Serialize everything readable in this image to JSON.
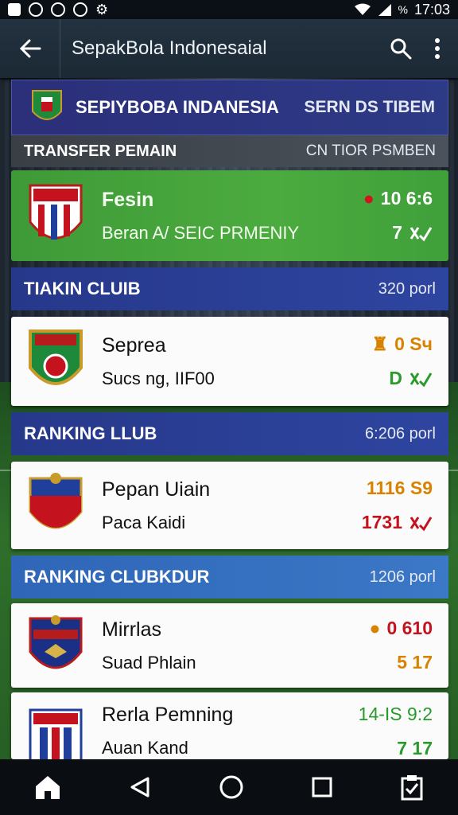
{
  "status": {
    "battery": "%",
    "time": "17:03"
  },
  "appbar": {
    "title": "SepakBola Indonesaial"
  },
  "header": {
    "league": "SEPIYBOBA INDANESIA",
    "right": "SERN DS TIBEM"
  },
  "transfer": {
    "title": "TRANSFER PEMAIN",
    "right": "CN TIOR PSMBEN"
  },
  "highlight": {
    "name": "Fesin",
    "sub": "Beran A/ SEIC PRMENIY",
    "stat1": "10 6:6",
    "stat2": "7"
  },
  "section1": {
    "title": "TIAKIN CLUIB",
    "meta": "320 porl"
  },
  "card1": {
    "name": "Seprea",
    "sub": "Sucs ng, IIF00",
    "stat1": "0 Sч",
    "stat2": "D"
  },
  "section2": {
    "title": "RANKING LLUB",
    "meta": "6:206 porl"
  },
  "card2": {
    "name": "Pepan Uiain",
    "sub": "Paca Kaidi",
    "stat1": "1116 S9",
    "stat2": "1731"
  },
  "section3": {
    "title": "RANKING CLUBKDUR",
    "meta": "1206 porl"
  },
  "card3": {
    "name": "Mirrlas",
    "sub": "Suad Phlain",
    "stat1": "0 610",
    "stat2": "5 17"
  },
  "card4": {
    "name": "Rerla Pemning",
    "sub": "Auan Kand",
    "stat1": "14-IS 9:2",
    "stat2": "7 17"
  },
  "colors": {
    "accent_green": "#3fa03a",
    "navy": "#2c2f7a",
    "blue": "#2f66b8",
    "orange": "#d98200",
    "red": "#c4121e",
    "check_green": "#2b9a2c"
  }
}
